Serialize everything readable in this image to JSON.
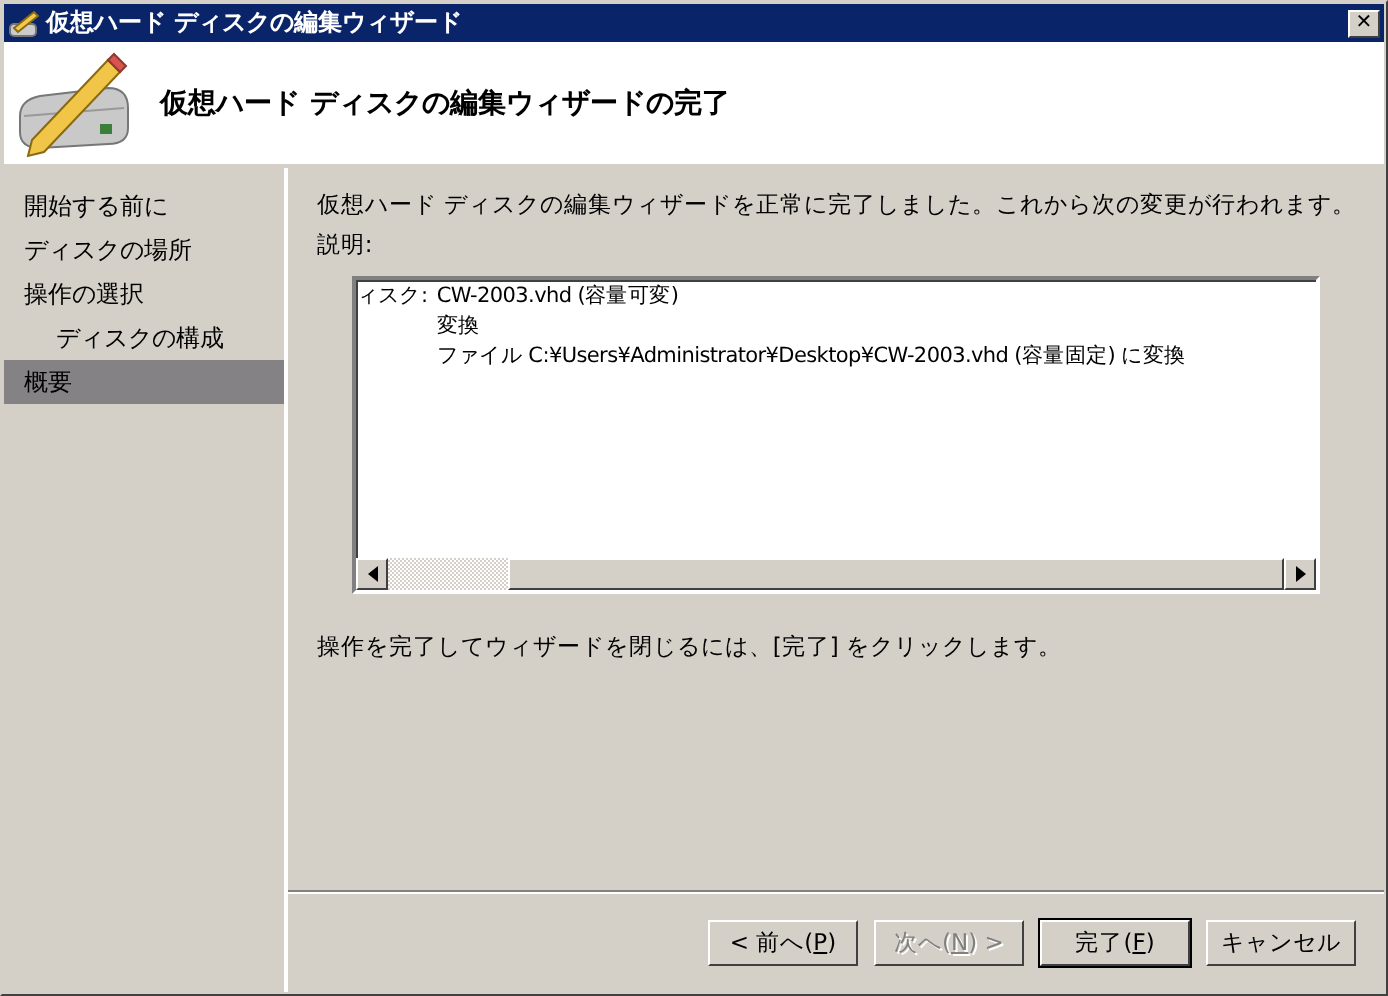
{
  "window": {
    "title": "仮想ハード ディスクの編集ウィザード",
    "close": "✕"
  },
  "header": {
    "title": "仮想ハード ディスクの編集ウィザードの完了"
  },
  "sidebar": {
    "items": [
      {
        "label": "開始する前に",
        "selected": false
      },
      {
        "label": "ディスクの場所",
        "selected": false
      },
      {
        "label": "操作の選択",
        "selected": false,
        "children": [
          {
            "label": "ディスクの構成",
            "selected": false
          }
        ]
      },
      {
        "label": "概要",
        "selected": true
      }
    ]
  },
  "content": {
    "intro": "仮想ハード ディスクの編集ウィザードを正常に完了しました。これから次の変更が行われます。",
    "description_label": "説明:",
    "description": [
      {
        "label": "ィスク:",
        "value": "CW-2003.vhd (容量可変)"
      },
      {
        "value": "変換"
      },
      {
        "value": "ファイル C:¥Users¥Administrator¥Desktop¥CW-2003.vhd (容量固定) に変換"
      }
    ],
    "footer": "操作を完了してウィザードを閉じるには、[完了] をクリックします。"
  },
  "buttons": [
    {
      "before": "< 前へ(",
      "key": "P",
      "after": ")",
      "disabled": false,
      "default": false
    },
    {
      "before": "次へ(",
      "key": "N",
      "after": ") >",
      "disabled": true,
      "default": false
    },
    {
      "before": "完了(",
      "key": "F",
      "after": ")",
      "disabled": false,
      "default": true
    },
    {
      "before": "キャンセル",
      "disabled": false,
      "default": false
    }
  ]
}
